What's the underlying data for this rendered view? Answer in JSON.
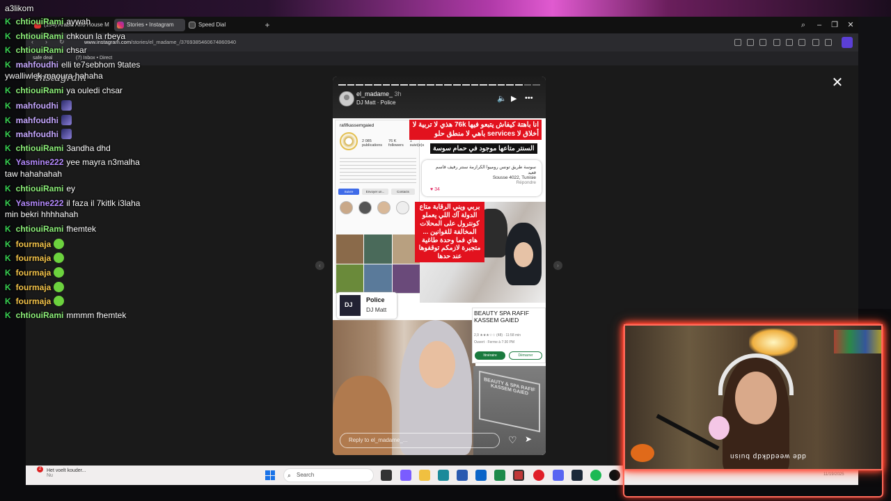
{
  "chat": {
    "top_partial": "a3likom",
    "lines": [
      {
        "user": "chtiouiRami",
        "msg": "aywah"
      },
      {
        "user": "chtiouiRami",
        "msg": "chkoun la rbeya"
      },
      {
        "user": "chtiouiRami",
        "msg": "chsar"
      },
      {
        "user": "mahfoudhi",
        "msg": "elli te7sebhom 9tates"
      },
      {
        "wrap": "ywalliwlek maoura hahaha"
      },
      {
        "user": "chtiouiRami",
        "msg": "ya ouledi chsar"
      },
      {
        "user": "mahfoudhi",
        "msg": ""
      },
      {
        "user": "mahfoudhi",
        "msg": ""
      },
      {
        "user": "mahfoudhi",
        "msg": ""
      },
      {
        "user": "chtiouiRami",
        "msg": "3andha dhd"
      },
      {
        "user": "Yasmine222",
        "msg": "yee mayra n3malha"
      },
      {
        "wrap": "taw hahahahah"
      },
      {
        "user": "chtiouiRami",
        "msg": "ey"
      },
      {
        "user": "Yasmine222",
        "msg": "il faza il 7kitlk i3laha"
      },
      {
        "wrap": "min bekri hhhhahah"
      },
      {
        "user": "chtiouiRami",
        "msg": "fhemtek"
      },
      {
        "user": "fourmaja",
        "msg": ""
      },
      {
        "user": "fourmaja",
        "msg": ""
      },
      {
        "user": "fourmaja",
        "msg": ""
      },
      {
        "user": "fourmaja",
        "msg": ""
      },
      {
        "user": "fourmaja",
        "msg": ""
      },
      {
        "user": "chtiouiRami",
        "msg": "mmmm fhemtek"
      }
    ]
  },
  "browser": {
    "tabs": [
      "(154) Arabic Afro House M",
      "Stories • Instagram",
      "Speed Dial"
    ],
    "url_prefix": "www.instagram.com",
    "url_path": "/stories/el_madame_/3769385460674860940",
    "bookmarks": [
      "safe deal",
      "(7) Inbox • Direct"
    ]
  },
  "instagram": {
    "logo": "Instagram",
    "story": {
      "username": "el_madame_",
      "time": "3h",
      "song": "DJ Matt · Police",
      "profile_handle": "rafifkassemgaied",
      "profile_stats": [
        "2 085",
        "76 K",
        "1"
      ],
      "profile_stat_labels": [
        "publications",
        "followers",
        "suivi(e)s"
      ],
      "profile_buttons": [
        "Suivre",
        "Envoyer un...",
        "Contacts"
      ],
      "red_text_1": "انا باهتة كيفاش يتبعو فيها 76k هذي لا تربية لا أخلاق لا services باهي لا منطق حلو",
      "black_tag": "السنتر متاعها موجود في حمام سوسة",
      "comment_text": "سوسة طريق تونس روميوا الكرازمة سنتر رفيف قاسم قعيد",
      "comment_sub": "Sousse 4022, Tunisie",
      "comment_reply": "Répondre",
      "comment_likes": "34",
      "red_text_2": "بربي ويني الرقابة متاع الدولة آك اللي يعملو كونترول على المحلات المخالفة للقوانين ... هاي فما وحدة طاغية متجبرة لازمكم توقفوها عند حدها",
      "music_title": "Police",
      "music_artist": "DJ Matt",
      "maps_title": "BEAUTY SPA RAFIF KASSEM GAIED",
      "maps_rating": "2,9 ★★★☆☆ (48) · 11:58 min",
      "maps_status": "Ouvert · Ferme à 7:30 PM",
      "maps_btn1": "Itinéraire",
      "maps_btn2": "Démarrer",
      "store_sign": "BEAUTY & SPA RAFIF KASSEM GAIED",
      "reply_placeholder": "Reply to el_madame_..."
    }
  },
  "taskbar": {
    "notification": "Het voelt kouder...",
    "notification_sub": "Nu",
    "notification_count": "2",
    "search_placeholder": "Search",
    "date": "11/19/2025"
  },
  "webcam": {
    "overlay_text": "dde weeddkdp buisn"
  },
  "colors": {
    "accent_purple": "#5b3fd6",
    "chat_green": "#39d353",
    "cam_border": "#ff6a5a",
    "story_red": "#e2121e"
  }
}
